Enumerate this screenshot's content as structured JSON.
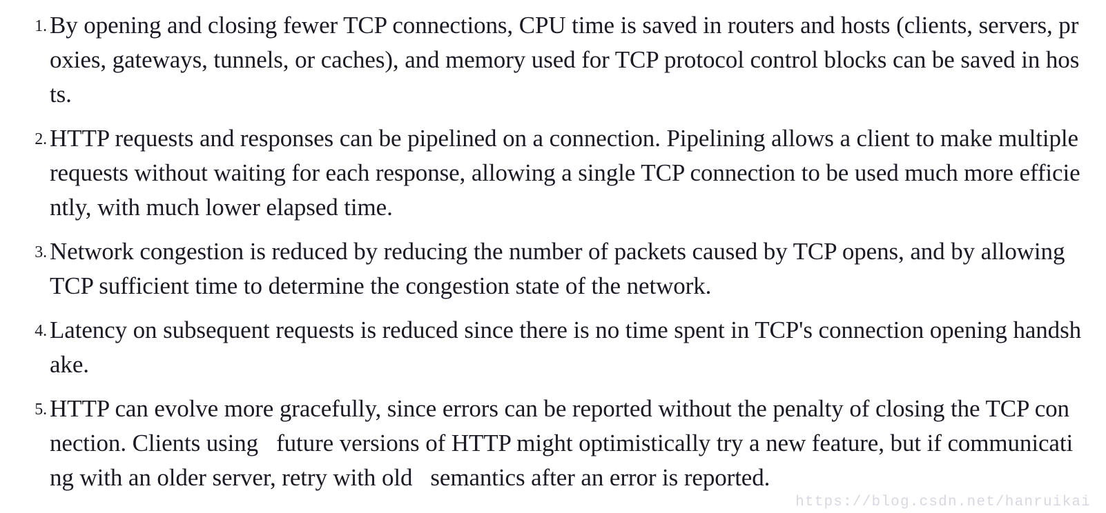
{
  "document": {
    "background_color": "#ffffff",
    "text_color": "#1a1a24",
    "list": {
      "type": "ordered",
      "items": [
        {
          "marker": "1.",
          "text": "By opening and closing fewer TCP connections, CPU time is saved in routers and hosts (clients, servers, proxies, gateways, tunnels, or caches), and memory used for TCP protocol control blocks can be saved in hosts."
        },
        {
          "marker": "2.",
          "text": "HTTP requests and responses can be pipelined on a connection. Pipelining allows a client to make multiple requests without waiting for each response, allowing a single TCP connection to be used much more efficiently, with much lower elapsed time."
        },
        {
          "marker": "3.",
          "text": "Network congestion is reduced by reducing the number of packets caused by TCP opens, and by allowing TCP sufficient time to determine the congestion state of the network."
        },
        {
          "marker": "4.",
          "text": "Latency on subsequent requests is reduced since there is no time spent in TCP's connection opening handshake."
        },
        {
          "marker": "5.",
          "text_part_1": "HTTP can evolve more gracefully, since errors can be reported without the penalty of closing the TCP connection. Clients using",
          "text_part_2": "future versions of HTTP might optimistically try a new feature, but if communicating with an older server, retry with old",
          "text_part_3": "semantics after an error is reported."
        }
      ]
    },
    "watermark": {
      "text": "https://blog.csdn.net/hanruikai",
      "color": "#d8d8e2"
    }
  }
}
